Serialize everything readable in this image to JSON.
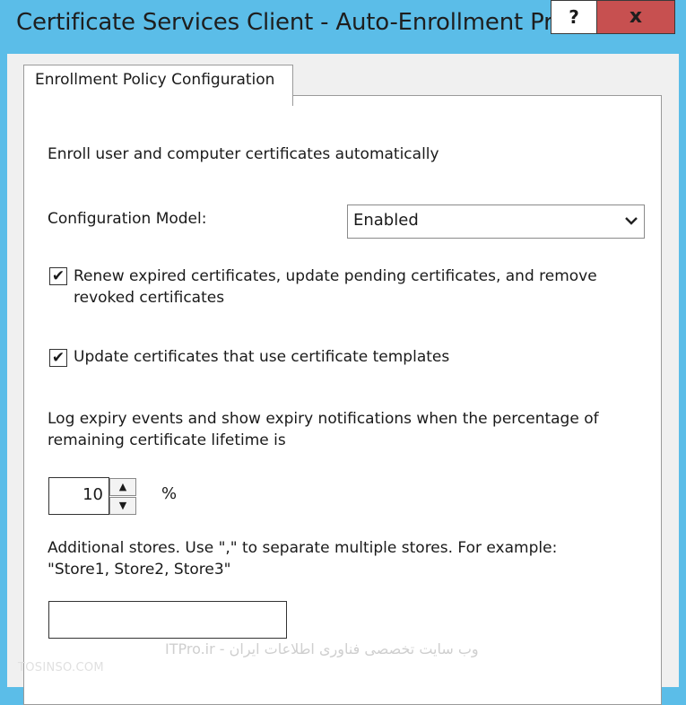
{
  "window": {
    "title": "Certificate Services Client - Auto-Enrollment Pr...",
    "help_label": "?",
    "close_label": "x",
    "colors": {
      "titlebar": "#5bbde8",
      "close": "#c75050"
    }
  },
  "tabs": [
    {
      "label": "Enrollment Policy Configuration",
      "selected": true
    }
  ],
  "panel": {
    "intro": "Enroll user and computer certificates automatically",
    "config_model_label": "Configuration Model:",
    "config_model_value": "Enabled",
    "renew": {
      "checked": true,
      "line1": "Renew expired certificates, update pending certificates, and remove",
      "line2": "revoked certificates"
    },
    "update_templates": {
      "checked": true,
      "label": "Update certificates that use certificate templates"
    },
    "expiry_line1": "Log expiry events and show expiry notifications when the percentage of",
    "expiry_line2": "remaining certificate lifetime is",
    "percent_value": "10",
    "percent_unit": "%",
    "stores_line1": "Additional stores. Use \",\" to separate multiple stores. For example:",
    "stores_line2": "\"Store1, Store2, Store3\"",
    "stores_value": ""
  },
  "icons": {
    "checkmark": "✔",
    "dropdown": "chevron-down-icon",
    "spin_up": "▲",
    "spin_down": "▼",
    "arrow": "⌄"
  },
  "watermark": {
    "site": "TOSINSO.COM",
    "text": "ITPro.ir - وب سایت تخصصی فناوری اطلاعات ایران"
  }
}
